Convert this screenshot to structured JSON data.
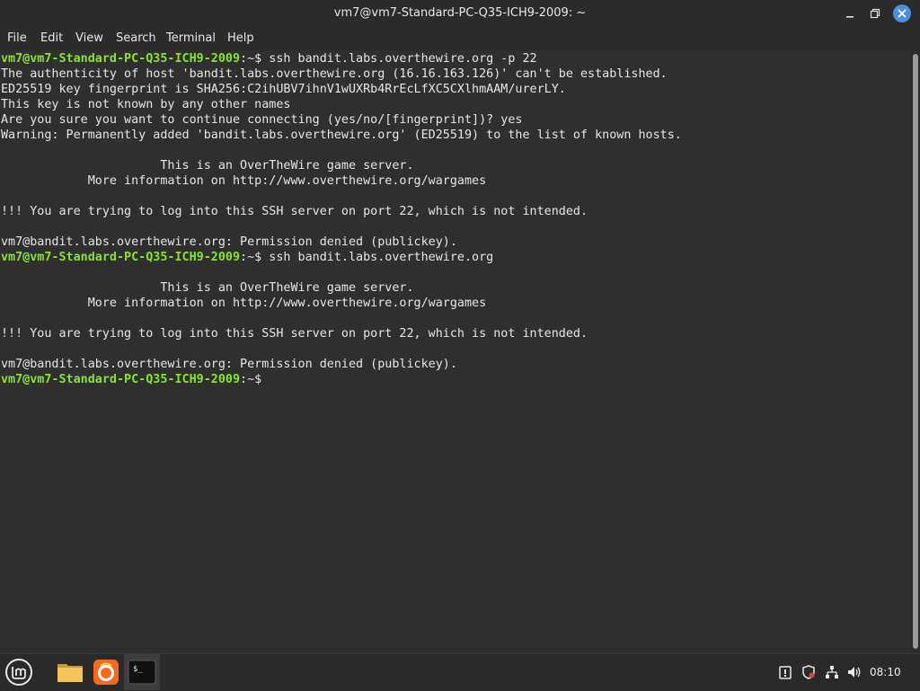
{
  "window": {
    "title": "vm7@vm7-Standard-PC-Q35-ICH9-2009: ~"
  },
  "menu": [
    "File",
    "Edit",
    "View",
    "Search",
    "Terminal",
    "Help"
  ],
  "prompt": {
    "user_host": "vm7@vm7-Standard-PC-Q35-ICH9-2009",
    "path": ":~$"
  },
  "terminal": {
    "lines": [
      {
        "type": "prompt",
        "cmd": " ssh bandit.labs.overthewire.org -p 22"
      },
      {
        "type": "text",
        "text": "The authenticity of host 'bandit.labs.overthewire.org (16.16.163.126)' can't be established."
      },
      {
        "type": "text",
        "text": "ED25519 key fingerprint is SHA256:C2ihUBV7ihnV1wUXRb4RrEcLfXC5CXlhmAAM/urerLY."
      },
      {
        "type": "text",
        "text": "This key is not known by any other names"
      },
      {
        "type": "text",
        "text": "Are you sure you want to continue connecting (yes/no/[fingerprint])? yes"
      },
      {
        "type": "text",
        "text": "Warning: Permanently added 'bandit.labs.overthewire.org' (ED25519) to the list of known hosts."
      },
      {
        "type": "text",
        "text": ""
      },
      {
        "type": "text",
        "text": "                      This is an OverTheWire game server."
      },
      {
        "type": "text",
        "text": "            More information on http://www.overthewire.org/wargames"
      },
      {
        "type": "text",
        "text": ""
      },
      {
        "type": "text",
        "text": "!!! You are trying to log into this SSH server on port 22, which is not intended."
      },
      {
        "type": "text",
        "text": ""
      },
      {
        "type": "text",
        "text": "vm7@bandit.labs.overthewire.org: Permission denied (publickey)."
      },
      {
        "type": "prompt",
        "cmd": " ssh bandit.labs.overthewire.org"
      },
      {
        "type": "text",
        "text": ""
      },
      {
        "type": "text",
        "text": "                      This is an OverTheWire game server."
      },
      {
        "type": "text",
        "text": "            More information on http://www.overthewire.org/wargames"
      },
      {
        "type": "text",
        "text": ""
      },
      {
        "type": "text",
        "text": "!!! You are trying to log into this SSH server on port 22, which is not intended."
      },
      {
        "type": "text",
        "text": ""
      },
      {
        "type": "text",
        "text": "vm7@bandit.labs.overthewire.org: Permission denied (publickey)."
      },
      {
        "type": "prompt",
        "cmd": ""
      }
    ]
  },
  "taskbar": {
    "launchers": [
      "menu-icon",
      "files-icon",
      "firefox-icon",
      "terminal-icon"
    ],
    "terminal_glyph": "$_",
    "tray": [
      "update-icon",
      "shield-icon",
      "network-icon",
      "volume-icon"
    ],
    "clock": "08:10"
  },
  "colors": {
    "prompt": "#8ae234",
    "text": "#e6e6e6",
    "background": "#2f2f2f",
    "close_button": "#4a90e2"
  }
}
